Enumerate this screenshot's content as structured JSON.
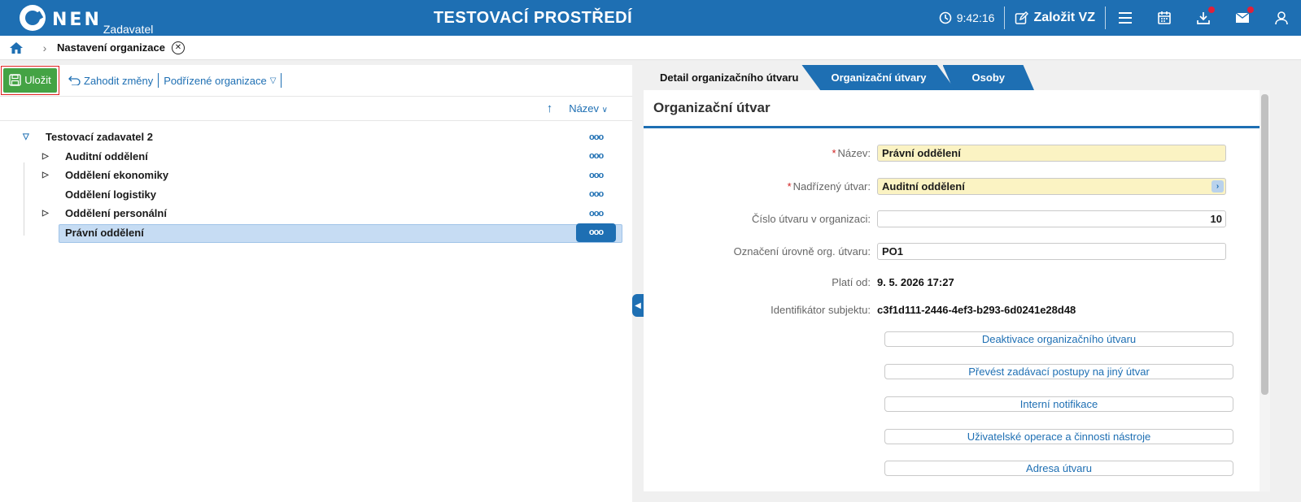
{
  "header": {
    "logo_text": "NEN",
    "logo_sub": "Zadavatel",
    "env_title": "TESTOVACÍ PROSTŘEDÍ",
    "time": "9:42:16",
    "create_label": "Založit VZ"
  },
  "breadcrumb": {
    "current": "Nastavení organizace"
  },
  "toolbar": {
    "save_label": "Uložit",
    "discard_label": "Zahodit změny",
    "sub_orgs_label": "Podřízené organizace"
  },
  "sort": {
    "label": "Název"
  },
  "tree": {
    "root": "Testovací zadavatel 2",
    "items": [
      {
        "label": "Auditní oddělení",
        "expandable": true
      },
      {
        "label": "Oddělení ekonomiky",
        "expandable": true
      },
      {
        "label": "Oddělení logistiky",
        "expandable": false
      },
      {
        "label": "Oddělení personální",
        "expandable": true
      },
      {
        "label": "Právní oddělení",
        "expandable": false,
        "selected": true
      }
    ],
    "more_glyph": "ooo"
  },
  "tabs": {
    "detail": "Detail organizačního útvaru",
    "units": "Organizační útvary",
    "persons": "Osoby"
  },
  "detail": {
    "section_title": "Organizační útvar",
    "name_label": "Název:",
    "name_value": "Právní oddělení",
    "parent_label": "Nadřízený útvar:",
    "parent_value": "Auditní oddělení",
    "number_label": "Číslo útvaru v organizaci:",
    "number_value": "10",
    "level_label": "Označení úrovně org. útvaru:",
    "level_value": "PO1",
    "valid_label": "Platí od:",
    "valid_value": "9. 5. 2026 17:27",
    "id_label": "Identifikátor subjektu:",
    "id_value": "c3f1d111-2446-4ef3-b293-6d0241e28d48"
  },
  "actions": {
    "deactivate": "Deaktivace organizačního útvaru",
    "transfer": "Převést zadávací postupy na jiný útvar",
    "notifications": "Interní notifikace",
    "user_ops": "Uživatelské operace a činnosti nástroje",
    "address": "Adresa útvaru"
  },
  "colors": {
    "brand": "#1e6fb3",
    "save": "#44a344",
    "required_field": "#fbf3c3",
    "notification_dot": "#e0203a"
  }
}
